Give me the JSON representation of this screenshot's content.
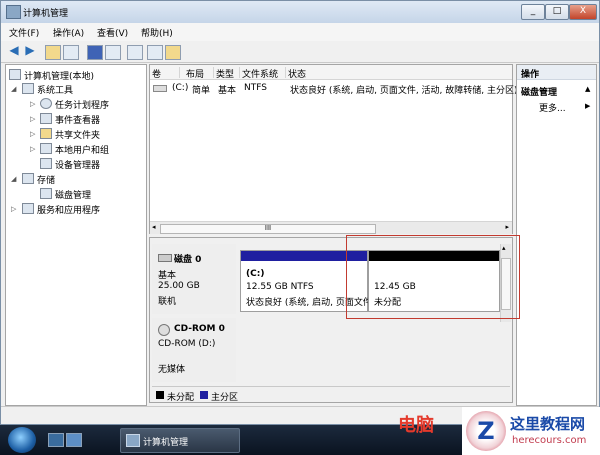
{
  "window": {
    "title": "计算机管理",
    "min": "_",
    "max": "□",
    "close": "X"
  },
  "menu": [
    "文件(F)",
    "操作(A)",
    "查看(V)",
    "帮助(H)"
  ],
  "tree": {
    "root": "计算机管理(本地)",
    "system_tools": "系统工具",
    "task_scheduler": "任务计划程序",
    "event_viewer": "事件查看器",
    "shared_folders": "共享文件夹",
    "local_users": "本地用户和组",
    "device_manager": "设备管理器",
    "storage": "存储",
    "disk_management": "磁盘管理",
    "services": "服务和应用程序"
  },
  "volume_list": {
    "columns": [
      "卷",
      "布局",
      "类型",
      "文件系统",
      "状态"
    ],
    "rows": [
      {
        "volume": "(C:)",
        "layout": "简单",
        "type": "基本",
        "fs": "NTFS",
        "status": "状态良好 (系统, 启动, 页面文件, 活动, 故障转储, 主分区)"
      }
    ],
    "hscroll_label": "III"
  },
  "disks": [
    {
      "name": "磁盘 0",
      "kind": "基本",
      "size": "25.00 GB",
      "status": "联机",
      "partitions": [
        {
          "label": "(C:)",
          "size": "12.55 GB NTFS",
          "status": "状态良好 (系统, 启动, 页面文件",
          "bar_color": "#1f1fa0"
        },
        {
          "label": "",
          "size": "12.45 GB",
          "status": "未分配",
          "bar_color": "#000000"
        }
      ]
    },
    {
      "name": "CD-ROM 0",
      "kind": "CD-ROM (D:)",
      "status": "无媒体"
    }
  ],
  "legend": [
    {
      "label": "未分配",
      "color": "#000000"
    },
    {
      "label": "主分区",
      "color": "#1f1fa0"
    }
  ],
  "actions": {
    "header": "操作",
    "section": "磁盘管理",
    "more": "更多..."
  },
  "taskbar": {
    "task_label": "计算机管理"
  },
  "watermark": {
    "red_text": "电脑",
    "logo_letter": "Z",
    "site_name": "这里教程网",
    "site_url": "herecours.com"
  }
}
